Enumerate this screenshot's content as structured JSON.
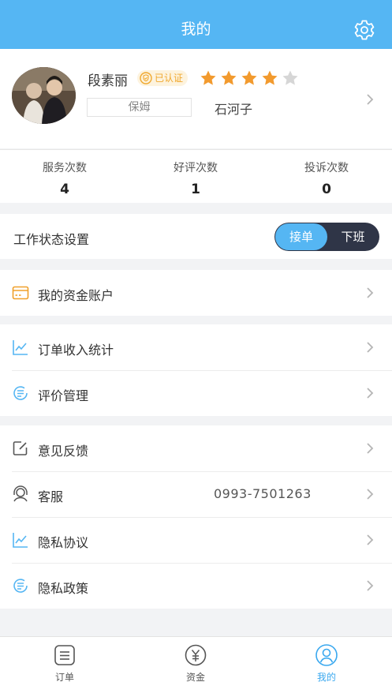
{
  "header": {
    "title": "我的",
    "settings_icon": "gear-icon"
  },
  "profile": {
    "name": "段素丽",
    "certified_label": "已认证",
    "rating": 4,
    "rating_max": 5,
    "role": "保姆",
    "city": "石河子"
  },
  "stats": [
    {
      "label": "服务次数",
      "value": "4"
    },
    {
      "label": "好评次数",
      "value": "1"
    },
    {
      "label": "投诉次数",
      "value": "0"
    }
  ],
  "work_status": {
    "label": "工作状态设置",
    "on_label": "接单",
    "off_label": "下班",
    "selected": "接单"
  },
  "menu": {
    "funds": {
      "label": "我的资金账户",
      "icon": "wallet-card-icon"
    },
    "order_stats": {
      "label": "订单收入统计",
      "icon": "line-chart-icon"
    },
    "reviews": {
      "label": "评价管理",
      "icon": "review-list-icon"
    },
    "feedback": {
      "label": "意见反馈",
      "icon": "edit-icon"
    },
    "service": {
      "label": "客服",
      "icon": "headset-icon",
      "phone": "0993-7501263"
    },
    "privacy_agreement": {
      "label": "隐私协议",
      "icon": "line-chart-icon"
    },
    "privacy_policy": {
      "label": "隐私政策",
      "icon": "review-list-icon"
    }
  },
  "tabs": [
    {
      "label": "订单",
      "icon": "order-list-icon",
      "active": false
    },
    {
      "label": "资金",
      "icon": "yuan-icon",
      "active": false
    },
    {
      "label": "我的",
      "icon": "user-icon",
      "active": true
    }
  ],
  "colors": {
    "primary": "#55b6f3",
    "star": "#f29a2e",
    "toggle_dark": "#2f3547",
    "cert": "#f0a82e"
  }
}
